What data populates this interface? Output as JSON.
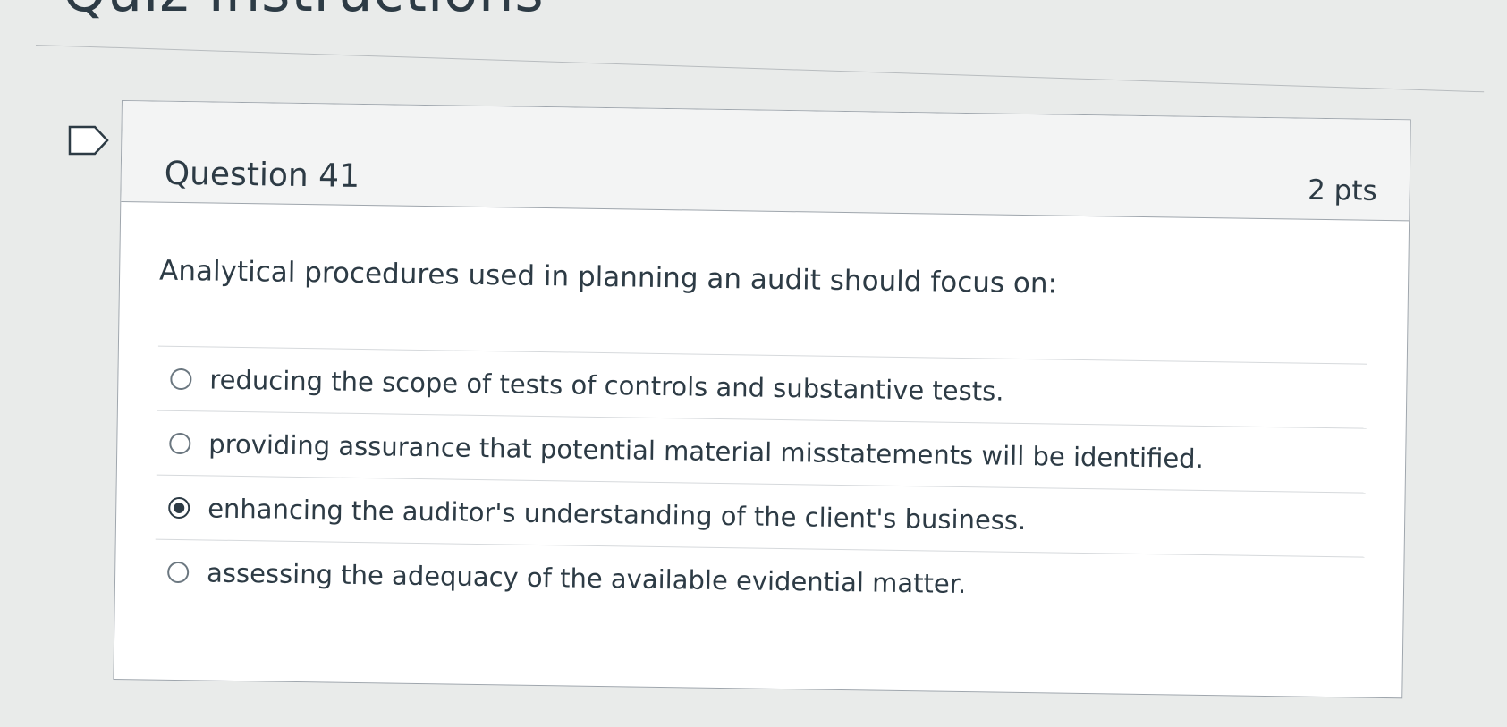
{
  "page": {
    "heading": "Quiz Instructions"
  },
  "question": {
    "title": "Question 41",
    "points": "2 pts",
    "text": "Analytical procedures used in planning an audit should focus on:",
    "flag_icon": "flag-icon",
    "answers": [
      {
        "label": "reducing the scope of tests of controls and substantive tests.",
        "selected": false
      },
      {
        "label": "providing assurance that potential material misstatements will be identified.",
        "selected": false
      },
      {
        "label": "enhancing the auditor's understanding of the client's business.",
        "selected": true
      },
      {
        "label": "assessing the adequacy of the available evidential matter.",
        "selected": false
      }
    ]
  },
  "colors": {
    "text": "#2d3b45",
    "border": "#9fa6ad",
    "header_bg": "#f3f4f4",
    "page_bg": "#e9ebea"
  }
}
